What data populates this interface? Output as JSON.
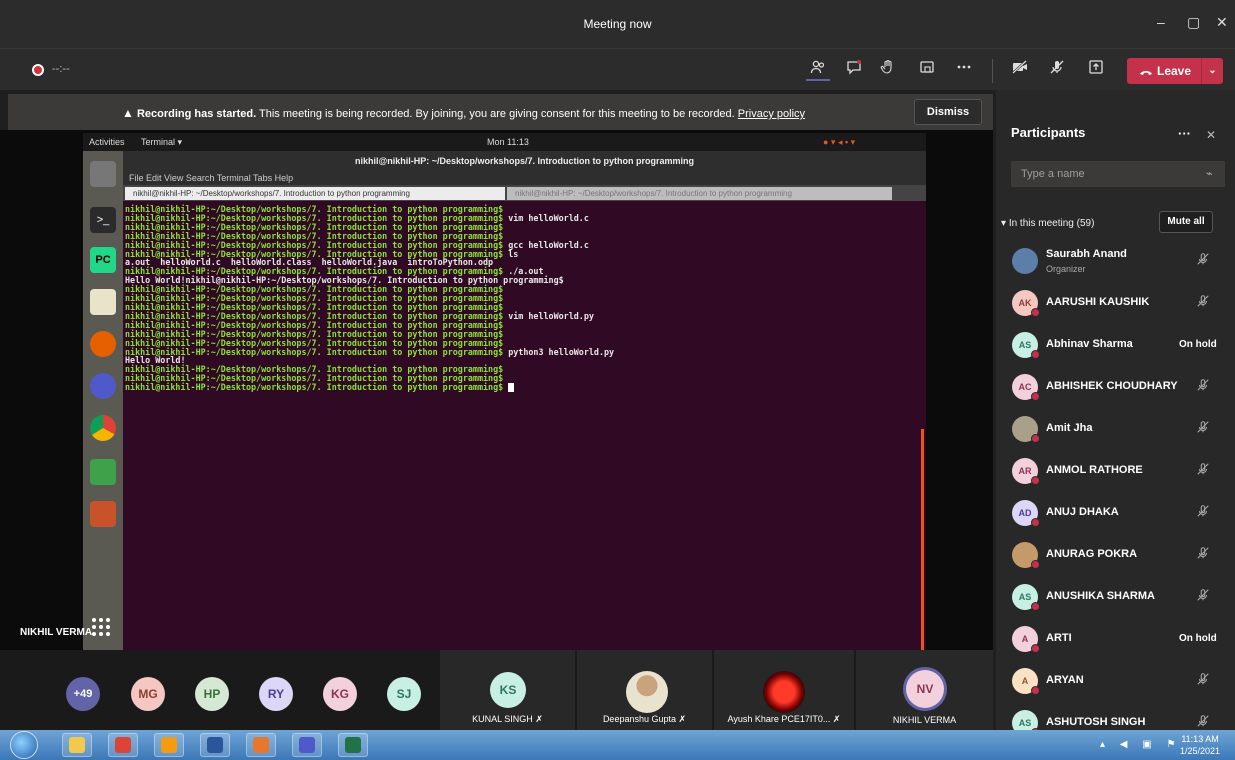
{
  "window": {
    "title": "Meeting now",
    "minimize": "–",
    "restore": "▢",
    "close": "✕"
  },
  "toolbar": {
    "timer": "--:--",
    "leave_label": "Leave",
    "icons": [
      "participants-icon",
      "chat-icon",
      "raise-hand-icon",
      "rooms-icon",
      "more-icon",
      "camera-off-icon",
      "mic-off-icon",
      "share-icon"
    ]
  },
  "banner": {
    "strong": "Recording has started.",
    "message": "This meeting is being recorded. By joining, you are giving consent for this meeting to be recorded.",
    "privacy": "Privacy policy",
    "dismiss": "Dismiss"
  },
  "shared_screen": {
    "topbar_activities": "Activities",
    "topbar_app": "Terminal ▾",
    "topbar_clock": "Mon 11:13",
    "terminal_title": "nikhil@nikhil-HP: ~/Desktop/workshops/7. Introduction to python programming",
    "terminal_menu": "File  Edit  View  Search  Terminal  Tabs  Help",
    "tabs": [
      "nikhil@nikhil-HP: ~/Desktop/workshops/7. Introduction to python programming",
      "nikhil@nikhil-HP: ~/Desktop/workshops/7. Introduction to python programming"
    ],
    "prompt": "nikhil@nikhil-HP:~/Desktop/workshops/7. Introduction to python programming$",
    "lines": [
      {
        "prompt": true,
        "cmd": ""
      },
      {
        "prompt": true,
        "cmd": " vim helloWorld.c"
      },
      {
        "prompt": true,
        "cmd": ""
      },
      {
        "prompt": true,
        "cmd": ""
      },
      {
        "prompt": true,
        "cmd": " gcc helloWorld.c"
      },
      {
        "prompt": true,
        "cmd": " ls"
      },
      {
        "prompt": false,
        "text": "a.out  helloWorld.c  helloWorld.class  helloWorld.java  introToPython.odp"
      },
      {
        "prompt": true,
        "cmd": " ./a.out"
      },
      {
        "prompt": false,
        "text": "Hello World!nikhil@nikhil-HP:~/Desktop/workshops/7. Introduction to python programming$"
      },
      {
        "prompt": true,
        "cmd": ""
      },
      {
        "prompt": true,
        "cmd": ""
      },
      {
        "prompt": true,
        "cmd": ""
      },
      {
        "prompt": true,
        "cmd": " vim helloWorld.py"
      },
      {
        "prompt": true,
        "cmd": ""
      },
      {
        "prompt": true,
        "cmd": ""
      },
      {
        "prompt": true,
        "cmd": ""
      },
      {
        "prompt": true,
        "cmd": " python3 helloWorld.py"
      },
      {
        "prompt": false,
        "text": "Hello World!"
      },
      {
        "prompt": true,
        "cmd": ""
      },
      {
        "prompt": true,
        "cmd": ""
      },
      {
        "prompt": true,
        "cmd": " ",
        "cursor": true
      }
    ],
    "presenter_name": "NIKHIL VERMA"
  },
  "strip": {
    "overflow": "+49",
    "avatars": [
      {
        "initials": "MG",
        "bg": "#f4c7c3",
        "fg": "#8e3f33"
      },
      {
        "initials": "HP",
        "bg": "#d5e8d4",
        "fg": "#3c6e3a"
      },
      {
        "initials": "RY",
        "bg": "#dcd6f7",
        "fg": "#4b3f94"
      },
      {
        "initials": "KG",
        "bg": "#f3d1dc",
        "fg": "#8e3356"
      },
      {
        "initials": "SJ",
        "bg": "#c8efe3",
        "fg": "#2f7560"
      }
    ],
    "tiles": [
      {
        "initials": "KS",
        "name": "KUNAL SINGH"
      },
      {
        "name": "Deepanshu Gupta"
      },
      {
        "name": "Ayush Khare PCE17IT0..."
      },
      {
        "initials": "NV",
        "name": "NIKHIL VERMA"
      }
    ]
  },
  "participants": {
    "header": "Participants",
    "more": "···",
    "close": "✕",
    "search_placeholder": "Type a name",
    "section": "In this meeting (59)",
    "mute_all": "Mute all",
    "list": [
      {
        "name": "Saurabh Anand",
        "role": "Organizer",
        "initials": "",
        "color": "#5b7fa8",
        "status": "mic"
      },
      {
        "name": "AARUSHI KAUSHIK",
        "initials": "AK",
        "color": "#f4c7c3",
        "fg": "#8e3f33",
        "status": "mic"
      },
      {
        "name": "Abhinav Sharma",
        "initials": "AS",
        "color": "#c8efe3",
        "fg": "#2f7560",
        "status": "hold",
        "hold_label": "On hold"
      },
      {
        "name": "ABHISHEK CHOUDHARY",
        "initials": "AC",
        "color": "#f3d1dc",
        "fg": "#8e3356",
        "status": "mic"
      },
      {
        "name": "Amit Jha",
        "initials": "",
        "color": "#a8a08a",
        "status": "mic"
      },
      {
        "name": "ANMOL RATHORE",
        "initials": "AR",
        "color": "#f3d1dc",
        "fg": "#8e3356",
        "status": "mic"
      },
      {
        "name": "ANUJ DHAKA",
        "initials": "AD",
        "color": "#dcd6f7",
        "fg": "#4b3f94",
        "status": "mic"
      },
      {
        "name": "ANURAG POKRA",
        "initials": "",
        "color": "#c59a6a",
        "status": "mic"
      },
      {
        "name": "ANUSHIKA SHARMA",
        "initials": "AS",
        "color": "#c8efe3",
        "fg": "#2f7560",
        "status": "mic"
      },
      {
        "name": "ARTI",
        "initials": "A",
        "color": "#f3d1dc",
        "fg": "#8e3356",
        "status": "hold",
        "hold_label": "On hold"
      },
      {
        "name": "ARYAN",
        "initials": "A",
        "color": "#fbe1c4",
        "fg": "#8a5a2b",
        "status": "mic"
      },
      {
        "name": "ASHUTOSH SINGH",
        "initials": "AS",
        "color": "#c8efe3",
        "fg": "#2f7560",
        "status": "mic"
      }
    ]
  },
  "taskbar": {
    "apps": [
      "folder-icon",
      "chrome-icon",
      "vpn-icon",
      "word-icon",
      "gadget-icon",
      "teams-icon",
      "excel-icon"
    ],
    "time": "11:13 AM",
    "date": "1/25/2021"
  },
  "colors": {
    "leave": "#c4314b",
    "accent": "#6264a7",
    "terminal_bg": "#300a24",
    "prompt": "#8ae234"
  }
}
